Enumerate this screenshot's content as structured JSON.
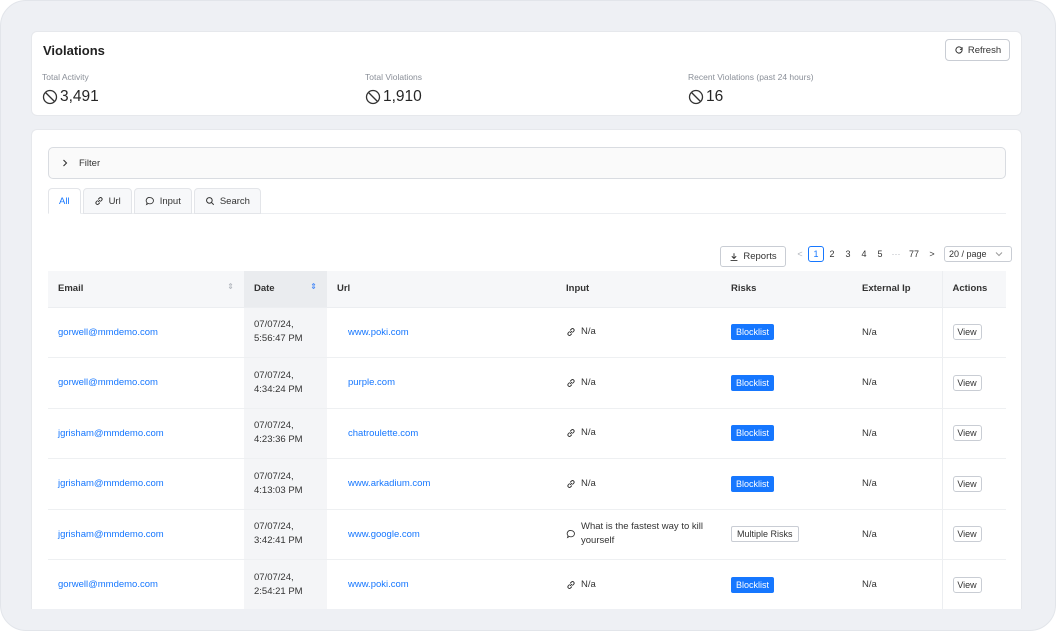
{
  "header": {
    "title": "Violations",
    "refresh_label": "Refresh"
  },
  "stats": [
    {
      "label": "Total Activity",
      "value": "3,491",
      "icon": "block-icon"
    },
    {
      "label": "Total Violations",
      "value": "1,910",
      "icon": "block-icon"
    },
    {
      "label": "Recent Violations (past 24 hours)",
      "value": "16",
      "icon": "block-icon"
    }
  ],
  "filter": {
    "label": "Filter"
  },
  "tabs": [
    {
      "label": "All",
      "icon": ""
    },
    {
      "label": "Url",
      "icon": "link-icon"
    },
    {
      "label": "Input",
      "icon": "chat-bubble-icon"
    },
    {
      "label": "Search",
      "icon": "search-icon"
    }
  ],
  "toolbar": {
    "reports_label": "Reports",
    "pages": [
      "1",
      "2",
      "3",
      "4",
      "5"
    ],
    "ellipsis": "···",
    "last_page": "77",
    "page_size": "20 / page"
  },
  "table": {
    "columns": [
      "Email",
      "Date",
      "Url",
      "Input",
      "Risks",
      "External Ip",
      "Actions"
    ],
    "rows": [
      {
        "email": "gorwell@mmdemo.com",
        "date1": "07/07/24,",
        "date2": "5:56:47 PM",
        "url": "www.poki.com",
        "input_icon": "link-icon",
        "input": "N/a",
        "risk": "Blocklist",
        "risk_style": "blue",
        "ip": "N/a",
        "action": "View"
      },
      {
        "email": "gorwell@mmdemo.com",
        "date1": "07/07/24,",
        "date2": "4:34:24 PM",
        "url": "purple.com",
        "input_icon": "link-icon",
        "input": "N/a",
        "risk": "Blocklist",
        "risk_style": "blue",
        "ip": "N/a",
        "action": "View"
      },
      {
        "email": "jgrisham@mmdemo.com",
        "date1": "07/07/24,",
        "date2": "4:23:36 PM",
        "url": "chatroulette.com",
        "input_icon": "link-icon",
        "input": "N/a",
        "risk": "Blocklist",
        "risk_style": "blue",
        "ip": "N/a",
        "action": "View"
      },
      {
        "email": "jgrisham@mmdemo.com",
        "date1": "07/07/24,",
        "date2": "4:13:03 PM",
        "url": "www.arkadium.com",
        "input_icon": "link-icon",
        "input": "N/a",
        "risk": "Blocklist",
        "risk_style": "blue",
        "ip": "N/a",
        "action": "View"
      },
      {
        "email": "jgrisham@mmdemo.com",
        "date1": "07/07/24,",
        "date2": "3:42:41 PM",
        "url": "www.google.com",
        "input_icon": "chat-bubble-icon",
        "input": "What is the fastest way to kill yourself",
        "risk": "Multiple Risks",
        "risk_style": "outline",
        "ip": "N/a",
        "action": "View"
      },
      {
        "email": "gorwell@mmdemo.com",
        "date1": "07/07/24,",
        "date2": "2:54:21 PM",
        "url": "www.poki.com",
        "input_icon": "link-icon",
        "input": "N/a",
        "risk": "Blocklist",
        "risk_style": "blue",
        "ip": "N/a",
        "action": "View"
      }
    ]
  }
}
